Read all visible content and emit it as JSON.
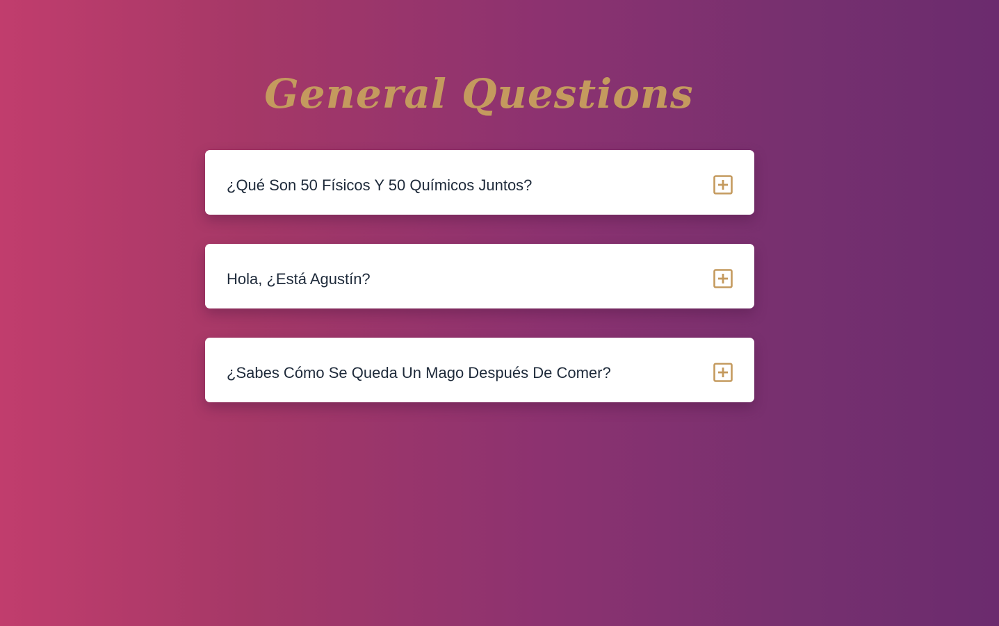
{
  "header": {
    "title": "General Questions"
  },
  "faq": {
    "items": [
      {
        "question": "¿Qué Son 50 Físicos Y 50 Químicos Juntos?"
      },
      {
        "question": "Hola, ¿Está Agustín?"
      },
      {
        "question": "¿Sabes Cómo Se Queda Un Mago Después De Comer?"
      }
    ],
    "toggle_icon": "plus-square-icon"
  },
  "colors": {
    "gradient_start": "#c13d6d",
    "gradient_end": "#6b2b6e",
    "accent_gold": "#c49a5e",
    "card_background": "#ffffff",
    "question_text": "#1e2a3a"
  }
}
